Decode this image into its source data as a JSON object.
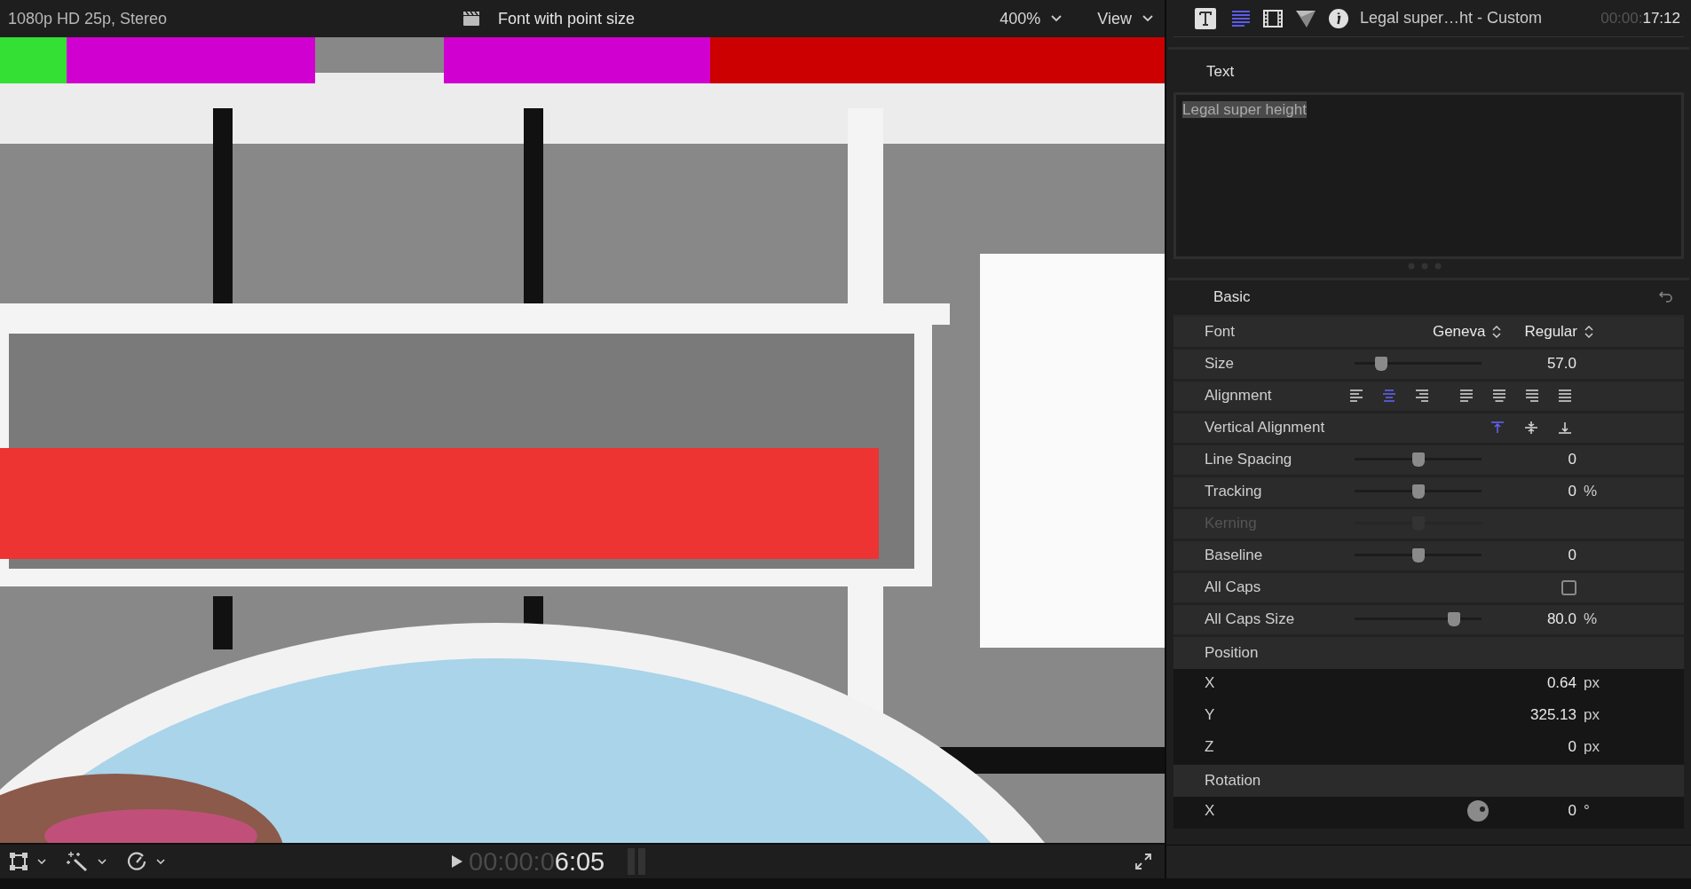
{
  "viewer": {
    "format": "1080p HD 25p, Stereo",
    "clip_title": "Font with point size",
    "zoom": "400%",
    "view_menu": "View"
  },
  "transport": {
    "timecode_dim": "00:00:0",
    "timecode": "6:05"
  },
  "inspector": {
    "tabs": [
      {
        "kind": "title",
        "selected": false
      },
      {
        "kind": "text",
        "selected": true
      },
      {
        "kind": "video",
        "selected": false
      },
      {
        "kind": "filter",
        "selected": false
      },
      {
        "kind": "info",
        "selected": false
      }
    ],
    "clip_name": "Legal super…ht - Custom",
    "timecode_dim": "00:00:",
    "timecode": "17:12",
    "text_section": {
      "title": "Text",
      "content": "Legal super height",
      "selected": true
    },
    "basic": {
      "title": "Basic",
      "rows": [
        {
          "kind": "popups",
          "label": "Font",
          "family": "Geneva",
          "style": "Regular"
        },
        {
          "kind": "slider",
          "label": "Size",
          "level": 0.21,
          "value": "57.0",
          "disabled": false
        },
        {
          "kind": "alignment",
          "label": "Alignment",
          "options": [
            {
              "selected": false
            },
            {
              "selected": true
            },
            {
              "selected": false
            },
            {
              "selected": false
            },
            {
              "selected": false
            },
            {
              "selected": false
            },
            {
              "selected": false
            }
          ]
        },
        {
          "kind": "valign",
          "label": "Vertical Alignment",
          "options": [
            {
              "selected": true
            },
            {
              "selected": false
            },
            {
              "selected": false
            }
          ]
        },
        {
          "kind": "slider",
          "label": "Line Spacing",
          "level": 0.5,
          "value": "0",
          "disabled": false
        },
        {
          "kind": "slider",
          "label": "Tracking",
          "level": 0.5,
          "value": "0",
          "unit": "%",
          "disabled": false
        },
        {
          "kind": "slider",
          "label": "Kerning",
          "level": 0.5,
          "disabled": true
        },
        {
          "kind": "slider",
          "label": "Baseline",
          "level": 0.5,
          "value": "0",
          "disabled": false
        },
        {
          "kind": "checkbox",
          "label": "All Caps",
          "checked": false
        },
        {
          "kind": "slider",
          "label": "All Caps Size",
          "level": 0.78,
          "value": "80.0",
          "unit": "%",
          "disabled": false
        },
        {
          "kind": "group",
          "label": "Position"
        },
        {
          "kind": "field",
          "label": "X",
          "value": "0.64",
          "unit": "px"
        },
        {
          "kind": "field",
          "label": "Y",
          "value": "325.13",
          "unit": "px"
        },
        {
          "kind": "field",
          "label": "Z",
          "value": "0",
          "unit": "px"
        },
        {
          "kind": "group",
          "label": "Rotation"
        },
        {
          "kind": "dial",
          "label": "X",
          "value": "0",
          "unit": "°"
        }
      ]
    }
  }
}
